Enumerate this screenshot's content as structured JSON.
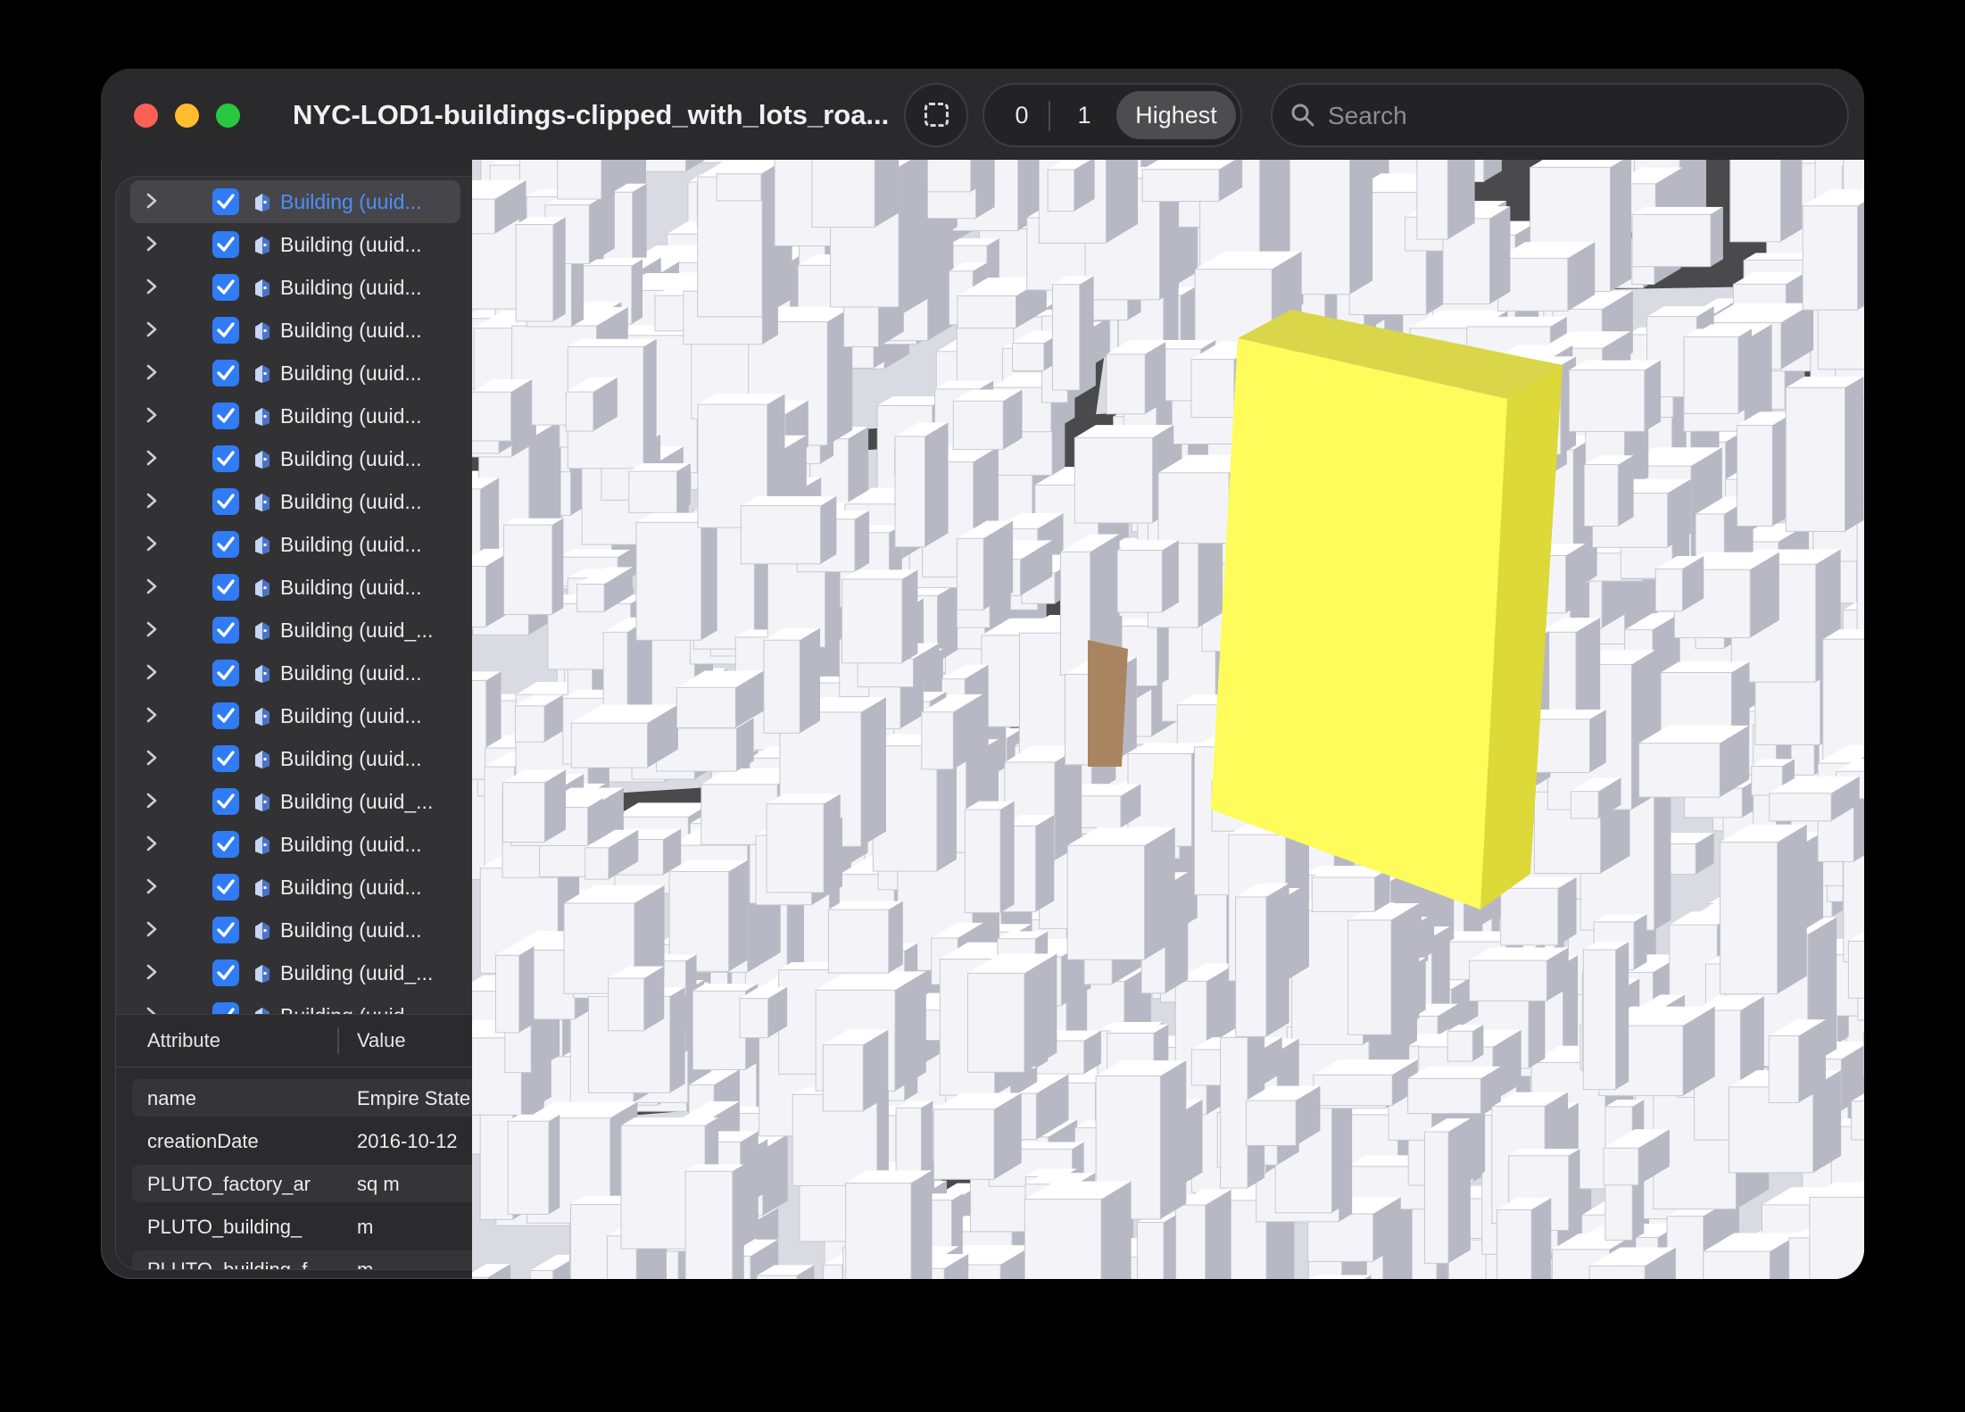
{
  "window": {
    "title": "NYC-LOD1-buildings-clipped_with_lots_roa..."
  },
  "toolbar": {
    "lod_options": [
      "0",
      "1",
      "Highest"
    ],
    "lod_selected": "Highest",
    "search_placeholder": "Search"
  },
  "sidebar": {
    "items": [
      {
        "label": "Building (uuid...",
        "checked": true,
        "selected": true
      },
      {
        "label": "Building (uuid...",
        "checked": true
      },
      {
        "label": "Building (uuid...",
        "checked": true
      },
      {
        "label": "Building (uuid...",
        "checked": true
      },
      {
        "label": "Building (uuid...",
        "checked": true
      },
      {
        "label": "Building (uuid...",
        "checked": true
      },
      {
        "label": "Building (uuid...",
        "checked": true
      },
      {
        "label": "Building (uuid...",
        "checked": true
      },
      {
        "label": "Building (uuid...",
        "checked": true
      },
      {
        "label": "Building (uuid...",
        "checked": true
      },
      {
        "label": "Building (uuid_...",
        "checked": true
      },
      {
        "label": "Building (uuid...",
        "checked": true
      },
      {
        "label": "Building (uuid...",
        "checked": true
      },
      {
        "label": "Building (uuid...",
        "checked": true
      },
      {
        "label": "Building (uuid_...",
        "checked": true
      },
      {
        "label": "Building (uuid...",
        "checked": true
      },
      {
        "label": "Building (uuid...",
        "checked": true
      },
      {
        "label": "Building (uuid...",
        "checked": true
      },
      {
        "label": "Building (uuid_...",
        "checked": true
      },
      {
        "label": "Building (uuid...",
        "checked": true
      }
    ]
  },
  "attributes": {
    "header": {
      "attribute": "Attribute",
      "value": "Value"
    },
    "rows": [
      {
        "key": "name",
        "value": "Empire State"
      },
      {
        "key": "creationDate",
        "value": "2016-10-12"
      },
      {
        "key": "PLUTO_factory_ar",
        "value": "sq m"
      },
      {
        "key": "PLUTO_building_",
        "value": "m"
      },
      {
        "key": "PLUTO_building_f",
        "value": "m"
      }
    ]
  },
  "viewport": {
    "highlight_color": "#fdfc5a",
    "building_color": "#f4f4f8",
    "road_color": "#4a4a4c"
  }
}
